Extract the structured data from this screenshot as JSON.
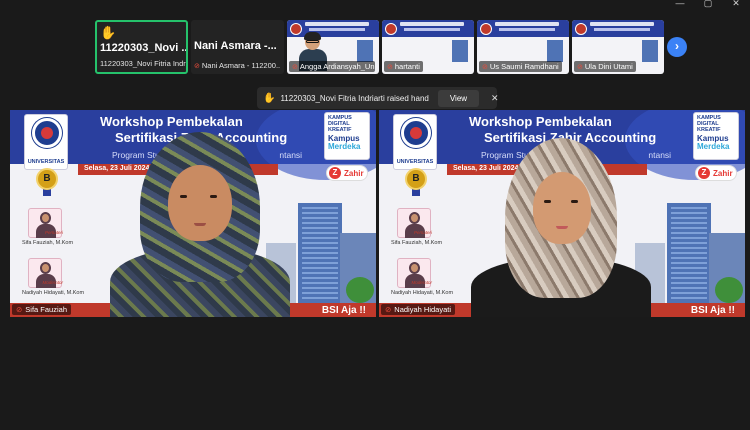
{
  "window_controls": {
    "minimize": "—",
    "maximize": "▢",
    "close": "✕"
  },
  "filmstrip": {
    "raised_tile": {
      "big_name": "11220303_Novi ...",
      "footer": "11220303_Novi Fitria Indri..."
    },
    "name_tile": {
      "big_name": "Nani Asmara -...",
      "footer": "Nani Asmara - 112200..."
    },
    "video_tiles": [
      {
        "footer": "Angga Ardiansyah_Uni..."
      },
      {
        "footer": "hartanti"
      },
      {
        "footer": "Us Saumi Ramdhani"
      },
      {
        "footer": "Ula Dini Utami"
      }
    ],
    "next_icon": "›"
  },
  "notification": {
    "icon": "✋",
    "message": "11220303_Novi Fitria Indriarti raised hand",
    "view_label": "View",
    "close_label": "✕"
  },
  "panes": [
    {
      "participant": "Sifa Fauziah",
      "slide": {
        "title_line1": "Workshop Pembekalan",
        "title_line2": "Sertifikasi Zahir Accounting",
        "subtitle": "Program Studi S",
        "subtitle_tail": "ntansi",
        "date": "Selasa, 23 Juli 2024",
        "date_extra": "",
        "uni_label": "UNIVERSITAS",
        "kampus_line1": "KAMPUS DIGITAL KREATIF",
        "kampus_line2a": "Kampus",
        "kampus_line2b": "Merdeka",
        "zahir": "Zahir",
        "medal": "B",
        "speaker1_role": "Pemateri",
        "speaker1_name": "Sifa Fauziah, M.Kom",
        "speaker2_role": "Moderator",
        "speaker2_name": "Nadiyah Hidayati, M.Kom",
        "tagline": "BSI Aja !!"
      }
    },
    {
      "participant": "Nadiyah Hidayati",
      "slide": {
        "title_line1": "Workshop Pembekalan",
        "title_line2": "Sertifikasi Zahir Accounting",
        "subtitle": "Program Studi S",
        "subtitle_tail": "ntansi",
        "date": "Selasa, 23 Juli 2024",
        "date_extra": "",
        "uni_label": "UNIVERSITAS",
        "kampus_line1": "KAMPUS DIGITAL KREATIF",
        "kampus_line2a": "Kampus",
        "kampus_line2b": "Merdeka",
        "zahir": "Zahir",
        "medal": "B",
        "speaker1_role": "Pemateri",
        "speaker1_name": "Sifa Fauziah, M.Kom",
        "speaker2_role": "Moderator",
        "speaker2_name": "Nadiyah Hidayati, M.Kom",
        "tagline": "BSI Aja !!"
      }
    }
  ],
  "colors": {
    "accent": "#25c26b",
    "slide_blue": "#2a3f9e",
    "slide_red": "#c0392b",
    "raise_yellow": "#f5c542"
  }
}
